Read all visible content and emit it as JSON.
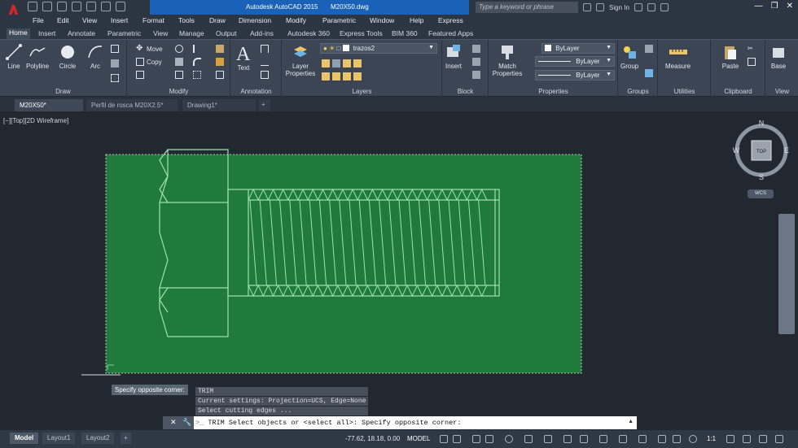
{
  "titlebar": {
    "app_name": "Autodesk AutoCAD 2015",
    "file_name": "M20X50.dwg",
    "search_placeholder": "Type a keyword or phrase",
    "sign_in": "Sign In"
  },
  "menu": [
    "File",
    "Edit",
    "View",
    "Insert",
    "Format",
    "Tools",
    "Draw",
    "Dimension",
    "Modify",
    "Parametric",
    "Window",
    "Help",
    "Express"
  ],
  "ribbon_tabs": [
    "Home",
    "Insert",
    "Annotate",
    "Parametric",
    "View",
    "Manage",
    "Output",
    "Add-ins",
    "Autodesk 360",
    "Express Tools",
    "BIM 360",
    "Featured Apps"
  ],
  "ribbon_active_tab": "Home",
  "panels": {
    "draw": {
      "title": "Draw",
      "tools": [
        "Line",
        "Polyline",
        "Circle",
        "Arc"
      ]
    },
    "modify": {
      "title": "Modify",
      "tools": [
        "Move",
        "Copy"
      ]
    },
    "annotation": {
      "title": "Annotation",
      "tools": [
        "Text"
      ]
    },
    "layers": {
      "title": "Layers",
      "layer_properties": "Layer Properties",
      "current_layer": "trazos2"
    },
    "block": {
      "title": "Block",
      "insert": "Insert"
    },
    "properties": {
      "title": "Properties",
      "match": "Match Properties",
      "color": "ByLayer",
      "linetype": "ByLayer",
      "lineweight": "ByLayer"
    },
    "groups": {
      "title": "Groups",
      "group": "Group"
    },
    "utilities": {
      "title": "Utilities",
      "measure": "Measure"
    },
    "clipboard": {
      "title": "Clipboard",
      "paste": "Paste"
    },
    "view": {
      "title": "View",
      "base": "Base"
    }
  },
  "doc_tabs": [
    "M20X50*",
    "Perfil de rosca M20X2.5*",
    "Drawing1*"
  ],
  "viewport": {
    "label": "[−][Top][2D Wireframe]",
    "viewcube": {
      "top": "TOP",
      "n": "N",
      "s": "S",
      "e": "E",
      "w": "W"
    },
    "wcs": "WCS"
  },
  "tooltip": "Specify opposite corner:",
  "command_history": [
    "TRIM",
    "Current settings: Projection=UCS, Edge=None",
    "Select cutting edges ..."
  ],
  "command_line": "TRIM Select objects or <select all>: Specify opposite corner:",
  "layout_tabs": [
    "Model",
    "Layout1",
    "Layout2"
  ],
  "status": {
    "coords": "-77.62, 18.18, 0.00",
    "mode": "MODEL",
    "scale": "1:1"
  },
  "colors": {
    "selection_fill": "#1f7a3c",
    "drawing_lines": "#9fe0b0",
    "accent": "#1a62b8",
    "background": "#212830"
  }
}
